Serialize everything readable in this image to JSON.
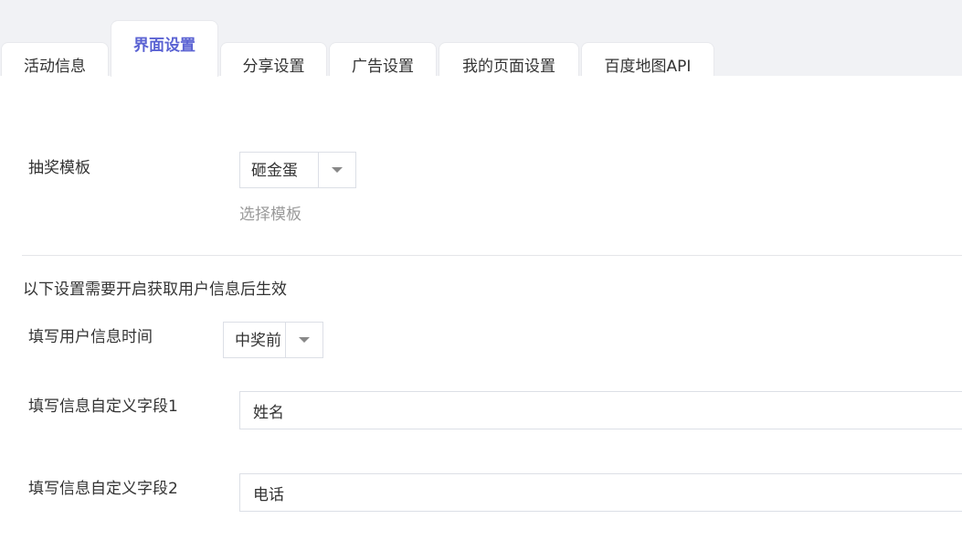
{
  "tabs": [
    {
      "label": "活动信息",
      "active": false
    },
    {
      "label": "界面设置",
      "active": true
    },
    {
      "label": "分享设置",
      "active": false
    },
    {
      "label": "广告设置",
      "active": false
    },
    {
      "label": "我的页面设置",
      "active": false
    },
    {
      "label": "百度地图API",
      "active": false
    }
  ],
  "form": {
    "template": {
      "label": "抽奖模板",
      "value": "砸金蛋",
      "hint": "选择模板"
    },
    "notice": "以下设置需要开启获取用户信息后生效",
    "fill_time": {
      "label": "填写用户信息时间",
      "value": "中奖前"
    },
    "field1": {
      "label": "填写信息自定义字段1",
      "value": "姓名"
    },
    "field2": {
      "label": "填写信息自定义字段2",
      "value": "电话"
    }
  },
  "colors": {
    "accent": "#5b63d3",
    "background": "#f1f2f5"
  }
}
